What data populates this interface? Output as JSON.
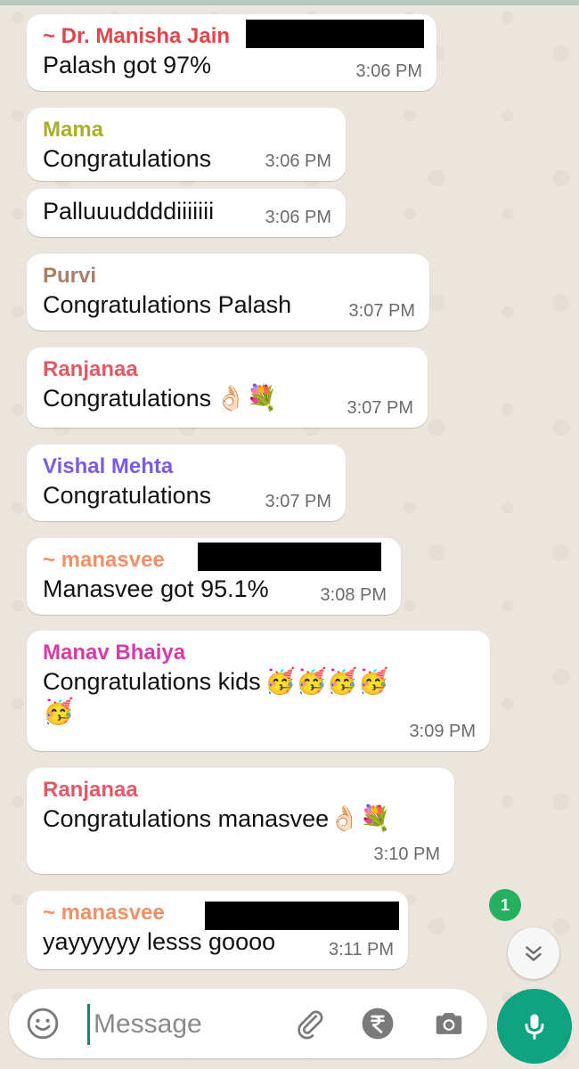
{
  "colors": {
    "chat_background": "#ece5dd",
    "bubble": "#ffffff",
    "accent_green": "#0fa37f",
    "badge_green": "#25b060"
  },
  "messages": [
    {
      "sender": "~ Dr. Manisha Jain",
      "sender_color": "#e0464b",
      "text": "Palash got 97%",
      "time": "3:06 PM",
      "redacted": true
    },
    {
      "sender": "Mama",
      "sender_color": "#a8b02a",
      "text": "Congratulations",
      "time": "3:06 PM"
    },
    {
      "text": "Palluuuddddiiiiiii",
      "time": "3:06 PM"
    },
    {
      "sender": "Purvi",
      "sender_color": "#a8806a",
      "text": "Congratulations Palash",
      "time": "3:07 PM"
    },
    {
      "sender": "Ranjanaa",
      "sender_color": "#e05a66",
      "text": "Congratulations",
      "emoji": "👌🏻💐",
      "time": "3:07 PM"
    },
    {
      "sender": "Vishal Mehta",
      "sender_color": "#7b5be0",
      "text": "Congratulations",
      "time": "3:07 PM"
    },
    {
      "sender": "~ manasvee",
      "sender_color": "#f0906a",
      "text": "Manasvee got 95.1%",
      "time": "3:08 PM",
      "redacted": true
    },
    {
      "sender": "Manav Bhaiya",
      "sender_color": "#d83aa8",
      "text": "Congratulations kids",
      "emoji": "🥳🥳🥳🥳",
      "emoji_line2": "🥳",
      "time": "3:09 PM"
    },
    {
      "sender": "Ranjanaa",
      "sender_color": "#e05a66",
      "text": "Congratulations manasvee",
      "emoji": "👌🏻💐",
      "time": "3:10 PM"
    },
    {
      "sender": "~ manasvee",
      "sender_color": "#f0906a",
      "text": "yayyyyyy lesss goooo",
      "time": "3:11 PM",
      "redacted": true
    }
  ],
  "unread_count": "1",
  "composer": {
    "placeholder": "Message",
    "icons": [
      "emoji-icon",
      "attach-icon",
      "rupee-payment-icon",
      "camera-icon",
      "mic-icon"
    ]
  },
  "scroll_button_icon": "double-chevron-down-icon"
}
